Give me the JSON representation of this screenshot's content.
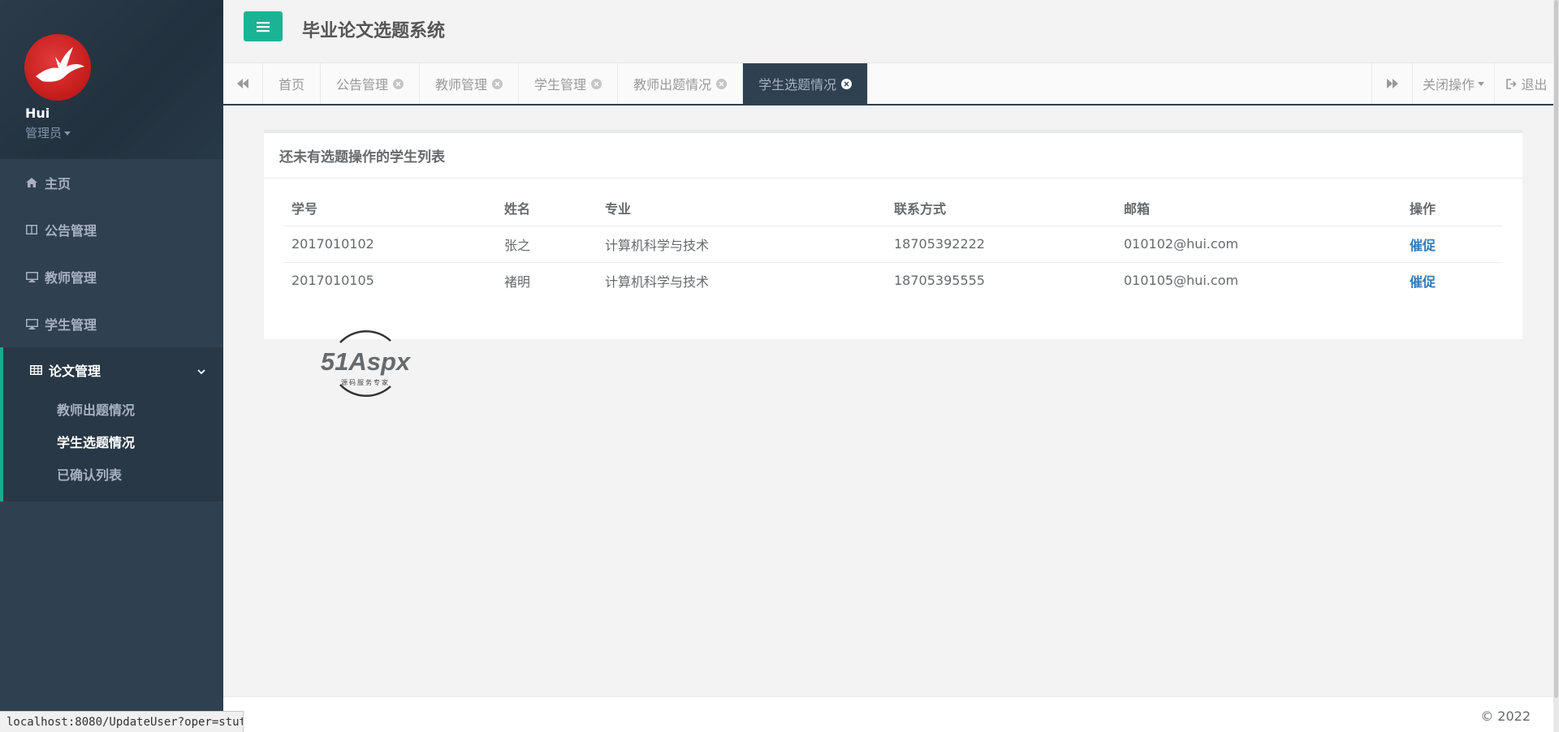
{
  "app": {
    "system_title": "毕业论文选题系统",
    "copyright": "© 2022"
  },
  "profile": {
    "name": "Hui",
    "role": "管理员"
  },
  "sidebar": {
    "items": [
      {
        "label": "主页",
        "icon": "home-icon"
      },
      {
        "label": "公告管理",
        "icon": "columns-icon"
      },
      {
        "label": "教师管理",
        "icon": "desktop-icon"
      },
      {
        "label": "学生管理",
        "icon": "desktop-icon"
      }
    ],
    "group": {
      "label": "论文管理",
      "icon": "table-icon",
      "sub_items": [
        {
          "label": "教师出题情况",
          "active": false
        },
        {
          "label": "学生选题情况",
          "active": true
        },
        {
          "label": "已确认列表",
          "active": false
        }
      ]
    }
  },
  "tabs": {
    "items": [
      {
        "label": "首页",
        "closable": false
      },
      {
        "label": "公告管理",
        "closable": true
      },
      {
        "label": "教师管理",
        "closable": true
      },
      {
        "label": "学生管理",
        "closable": true
      },
      {
        "label": "教师出题情况",
        "closable": true
      },
      {
        "label": "学生选题情况",
        "closable": true,
        "active": true
      }
    ],
    "close_ops_label": "关闭操作",
    "logout_label": "退出"
  },
  "card": {
    "title": "还未有选题操作的学生列表",
    "columns": [
      "学号",
      "姓名",
      "专业",
      "联系方式",
      "邮箱",
      "操作"
    ],
    "rows": [
      {
        "id": "2017010102",
        "name": "张之",
        "major": "计算机科学与技术",
        "phone": "18705392222",
        "email": "010102@hui.com",
        "action": "催促"
      },
      {
        "id": "2017010105",
        "name": "褚明",
        "major": "计算机科学与技术",
        "phone": "18705395555",
        "email": "010105@hui.com",
        "action": "催促"
      }
    ]
  },
  "watermark": {
    "brand": "51Aspx",
    "tagline": "源码服务专家"
  },
  "statusbar": {
    "url": "localhost:8080/UpdateUser?oper=stuth"
  },
  "colors": {
    "accent": "#1ab394",
    "sidebar_bg": "#2f4050",
    "link": "#337ab7"
  }
}
